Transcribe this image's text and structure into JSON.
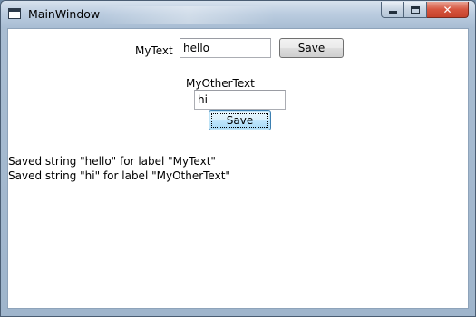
{
  "window": {
    "title": "MainWindow",
    "minimize_icon": "minimize-icon",
    "maximize_icon": "maximize-icon",
    "close_icon": "close-icon",
    "close_glyph": "✕"
  },
  "form": {
    "row1": {
      "label": "MyText",
      "value": "hello",
      "save_label": "Save"
    },
    "row2": {
      "label": "MyOtherText",
      "value": "hi",
      "save_label": "Save"
    }
  },
  "log": {
    "lines": [
      "Saved string \"hello\" for label \"MyText\"",
      "Saved string \"hi\" for label \"MyOtherText\""
    ]
  }
}
